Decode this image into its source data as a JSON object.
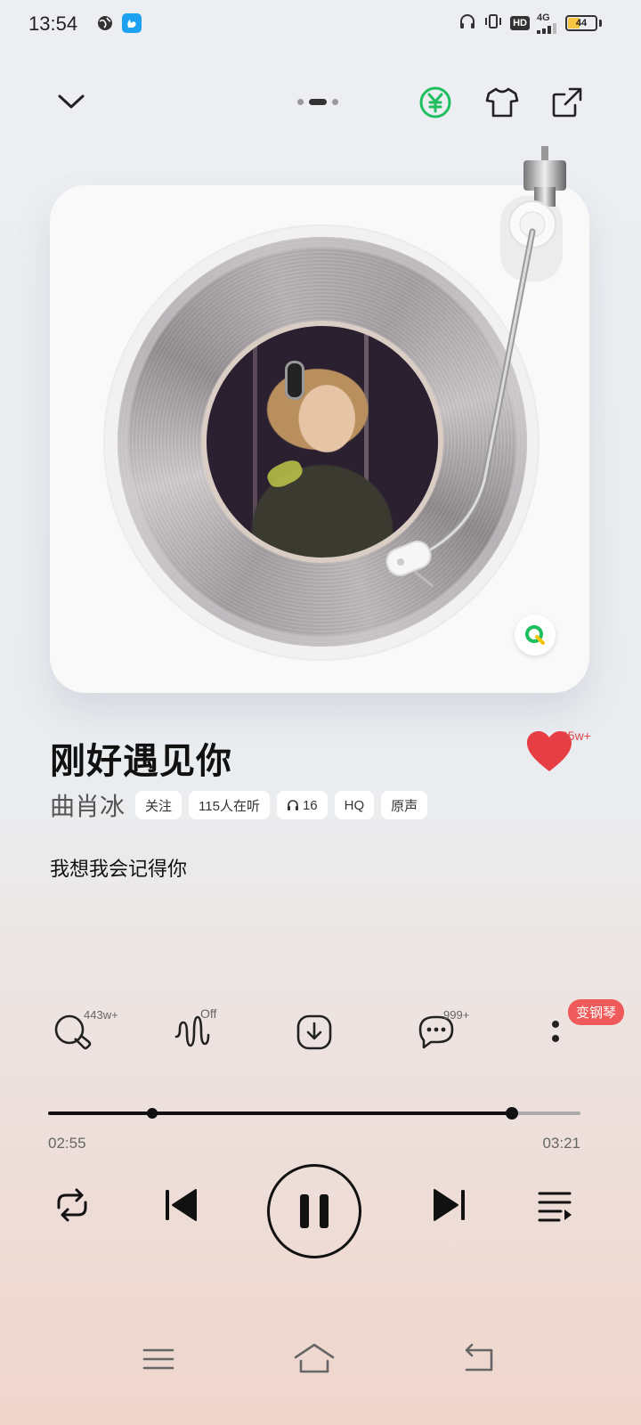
{
  "status_bar": {
    "time": "13:54",
    "network": "4G",
    "hd": "HD",
    "battery": "44",
    "battery_level": 0.44
  },
  "top_nav": {
    "page_count": 3,
    "active_page": 1
  },
  "song": {
    "title": "刚好遇见你",
    "artist": "曲肖冰",
    "like_count": "95w+",
    "current_lyric": "我想我会记得你"
  },
  "chips": {
    "follow": "关注",
    "listeners": "115人在听",
    "headphone_count": "16",
    "quality": "HQ",
    "original": "原声"
  },
  "actions": {
    "search_count": "443w+",
    "effect_state": "Off",
    "comment_count": "999+",
    "piano_badge": "变钢琴"
  },
  "progress": {
    "current_time": "02:55",
    "total_time": "03:21",
    "played_fraction": 0.871,
    "marker_fraction": 0.195
  },
  "colors": {
    "accent_green": "#1fbf5f",
    "like_red": "#e63e44",
    "badge_red": "#ef5b5b"
  },
  "icons": {
    "collapse": "chevron-down-icon",
    "vip": "yuan-icon",
    "skin": "tshirt-icon",
    "share": "share-icon",
    "qq_music": "qq-music-icon",
    "loop": "repeat-icon",
    "prev": "skip-previous-icon",
    "pause": "pause-icon",
    "next": "skip-next-icon",
    "playlist": "playlist-icon"
  }
}
